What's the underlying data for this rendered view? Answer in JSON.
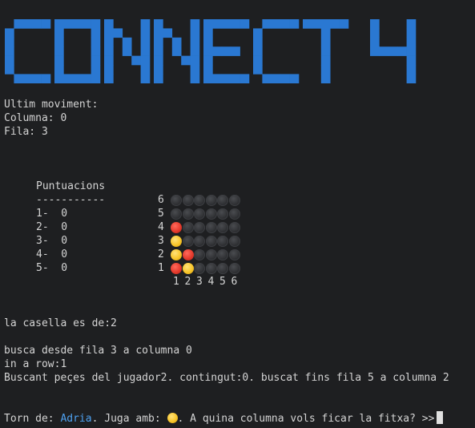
{
  "banner": {
    "text": "CONNECT 4",
    "color": "#2a78d2"
  },
  "last_move": {
    "heading": "Ultim moviment:",
    "column_line": "Columna: 0",
    "row_line": "Fila: 3"
  },
  "scores": {
    "title": "Puntuacions",
    "divider": "-----------",
    "rows": [
      "1-  0",
      "2-  0",
      "3-  0",
      "4-  0",
      "5-  0"
    ]
  },
  "board": {
    "row_labels": [
      "6",
      "5",
      "4",
      "3",
      "2",
      "1"
    ],
    "col_labels": [
      "1",
      "2",
      "3",
      "4",
      "5",
      "6"
    ],
    "cells": [
      [
        "empty",
        "empty",
        "empty",
        "empty",
        "empty",
        "empty"
      ],
      [
        "empty",
        "empty",
        "empty",
        "empty",
        "empty",
        "empty"
      ],
      [
        "red",
        "empty",
        "empty",
        "empty",
        "empty",
        "empty"
      ],
      [
        "yellow",
        "empty",
        "empty",
        "empty",
        "empty",
        "empty"
      ],
      [
        "yellow",
        "red",
        "empty",
        "empty",
        "empty",
        "empty"
      ],
      [
        "red",
        "yellow",
        "empty",
        "empty",
        "empty",
        "empty"
      ]
    ]
  },
  "log": {
    "cell_line": "la casella es de:2",
    "search_line": "busca desde fila 3 a columna 0",
    "in_row_line": "in a row:1",
    "searching_line": "Buscant peçes del jugador2. contingut:0. buscat fins fila 5 a columna 2"
  },
  "prompt": {
    "turn_prefix": "Torn de: ",
    "player_name": "Adria",
    "plays_with": ". Juga amb: ",
    "question": ". A quina columna vols ficar la fitxa? >>",
    "disc_color": "yellow"
  }
}
